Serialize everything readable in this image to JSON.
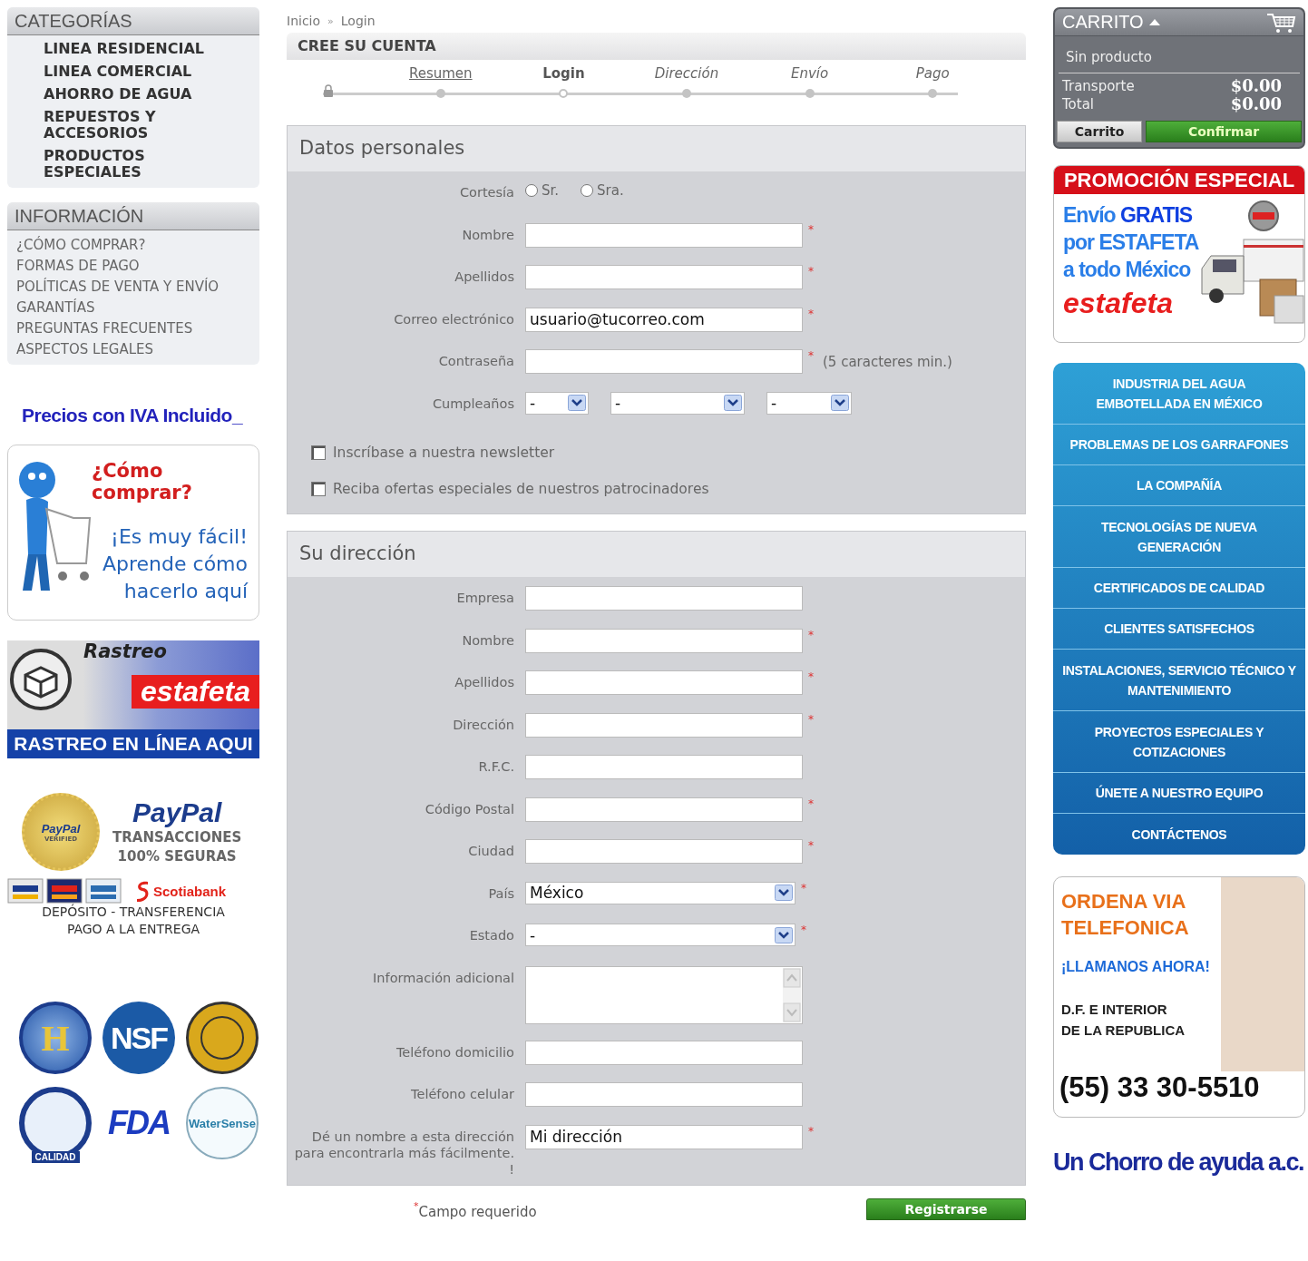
{
  "categories": {
    "title": "CATEGORÍAS",
    "items": [
      "LINEA RESIDENCIAL",
      "LINEA COMERCIAL",
      "AHORRO DE AGUA",
      "REPUESTOS Y ACCESORIOS",
      "PRODUCTOS ESPECIALES"
    ]
  },
  "information": {
    "title": "INFORMACIÓN",
    "items": [
      "¿CÓMO COMPRAR?",
      "FORMAS DE PAGO",
      "POLÍTICAS DE VENTA Y ENVÍO",
      "GARANTÍAS",
      "PREGUNTAS FRECUENTES",
      "ASPECTOS LEGALES"
    ]
  },
  "iva_note": "Precios con IVA Incluido_",
  "how_to_banner": {
    "title": "¿Cómo comprar?",
    "lines": [
      "¡Es muy fácil!",
      "Aprende cómo",
      "hacerlo aquí"
    ]
  },
  "tracking_banner": {
    "title": "Rastreo",
    "brand": "estafeta",
    "caption": "RASTREO EN LÍNEA AQUI"
  },
  "payment": {
    "seal": [
      "PayPal",
      "VERIFIED"
    ],
    "logo": "PayPal",
    "lines": [
      "TRANSACCIONES",
      "100% SEGURAS"
    ],
    "cards": [
      {
        "kind": "visa"
      },
      {
        "kind": "mastercard"
      },
      {
        "kind": "amex"
      }
    ],
    "bank": "Scotiabank",
    "methods": [
      "DEPÓSITO - TRANSFERENCIA",
      "PAGO A LA ENTREGA"
    ]
  },
  "certifications": [
    {
      "kind": "distintivo",
      "label": "H"
    },
    {
      "kind": "nsf",
      "label": "NSF"
    },
    {
      "kind": "seal"
    },
    {
      "kind": "imta",
      "label": "CALIDAD"
    },
    {
      "kind": "fda",
      "label": "FDA"
    },
    {
      "kind": "watersense",
      "label": "WaterSense"
    }
  ],
  "breadcrumb": {
    "items": [
      "Inicio",
      "Login"
    ],
    "separator": "»"
  },
  "page_title": "CREE SU CUENTA",
  "steps": [
    {
      "label": "Resumen",
      "completed": true,
      "selected": false
    },
    {
      "label": "Login",
      "completed": false,
      "selected": true
    },
    {
      "label": "Dirección",
      "completed": false,
      "selected": false
    },
    {
      "label": "Envío",
      "completed": false,
      "selected": false
    },
    {
      "label": "Pago",
      "completed": false,
      "selected": false
    }
  ],
  "required_mark": "*",
  "sections": [
    {
      "title": "Datos personales",
      "rows": [
        {
          "kind": "radio",
          "label": "Cortesía",
          "options": [
            {
              "label": "Sr.",
              "selected": false
            },
            {
              "label": "Sra.",
              "selected": false
            }
          ]
        },
        {
          "kind": "text",
          "label": "Nombre",
          "required": true
        },
        {
          "kind": "text",
          "label": "Apellidos",
          "required": true
        },
        {
          "kind": "text",
          "label": "Correo electrónico",
          "value": "usuario@tucorreo.com",
          "required": true
        },
        {
          "kind": "password",
          "label": "Contraseña",
          "required": true,
          "hint": "(5 caracteres min.)"
        },
        {
          "kind": "date",
          "label": "Cumpleaños",
          "selects": [
            "-",
            "-",
            "-"
          ]
        },
        {
          "kind": "checkbox",
          "label": "Inscríbase a nuestra newsletter",
          "checked": false
        },
        {
          "kind": "checkbox",
          "label": "Reciba ofertas especiales de nuestros patrocinadores",
          "checked": false
        }
      ]
    },
    {
      "title": "Su dirección",
      "rows": [
        {
          "kind": "text",
          "label": "Empresa",
          "required": false
        },
        {
          "kind": "text",
          "label": "Nombre",
          "required": true
        },
        {
          "kind": "text",
          "label": "Apellidos",
          "required": true
        },
        {
          "kind": "text",
          "label": "Dirección",
          "required": true
        },
        {
          "kind": "text",
          "label": "R.F.C.",
          "required": false
        },
        {
          "kind": "text",
          "label": "Código Postal",
          "required": true
        },
        {
          "kind": "text",
          "label": "Ciudad",
          "required": true
        },
        {
          "kind": "select",
          "label": "País",
          "value": "México",
          "required": true
        },
        {
          "kind": "select",
          "label": "Estado",
          "value": "-",
          "required": true
        },
        {
          "kind": "textarea",
          "label": "Información adicional",
          "required": false
        },
        {
          "kind": "text",
          "label": "Teléfono domicilio",
          "required": false
        },
        {
          "kind": "text",
          "label": "Teléfono celular",
          "required": false
        },
        {
          "kind": "text",
          "label": "Dé un nombre a esta dirección para encontrarla más fácilmente. !",
          "value": "Mi dirección",
          "required": true
        }
      ]
    }
  ],
  "required_note": "Campo requerido",
  "submit": "Registrarse",
  "cart": {
    "title": "CARRITO",
    "status": "Sin producto",
    "totals": [
      {
        "label": "Transporte",
        "value": "$0.00"
      },
      {
        "label": "Total",
        "value": "$0.00"
      }
    ],
    "buttons": [
      "Carrito",
      "Confirmar"
    ]
  },
  "promo": {
    "title": "PROMOCIÓN ESPECIAL",
    "lines": [
      "Envío **GRATIS**",
      "por ESTAFETA",
      "a todo México"
    ],
    "brand": "estafeta"
  },
  "menu": [
    "INDUSTRIA DEL AGUA EMBOTELLADA EN MÉXICO",
    "PROBLEMAS DE LOS GARRAFONES",
    "LA COMPAÑÍA",
    "TECNOLOGÍAS DE NUEVA GENERACIÓN",
    "CERTIFICADOS DE CALIDAD",
    "CLIENTES SATISFECHOS",
    "INSTALACIONES, SERVICIO TÉCNICO Y MANTENIMIENTO",
    "PROYECTOS ESPECIALES Y COTIZACIONES",
    "ÚNETE A NUESTRO EQUIPO",
    "CONTÁCTENOS"
  ],
  "phone_banner": {
    "title": [
      "ORDENA VIA",
      "TELEFONICA"
    ],
    "call": "¡LLAMANOS AHORA!",
    "region": [
      "D.F. E INTERIOR",
      "DE LA REPUBLICA"
    ],
    "phone": "(55) 33 30-5510"
  },
  "slogan": "Un Chorro de ayuda a.c."
}
